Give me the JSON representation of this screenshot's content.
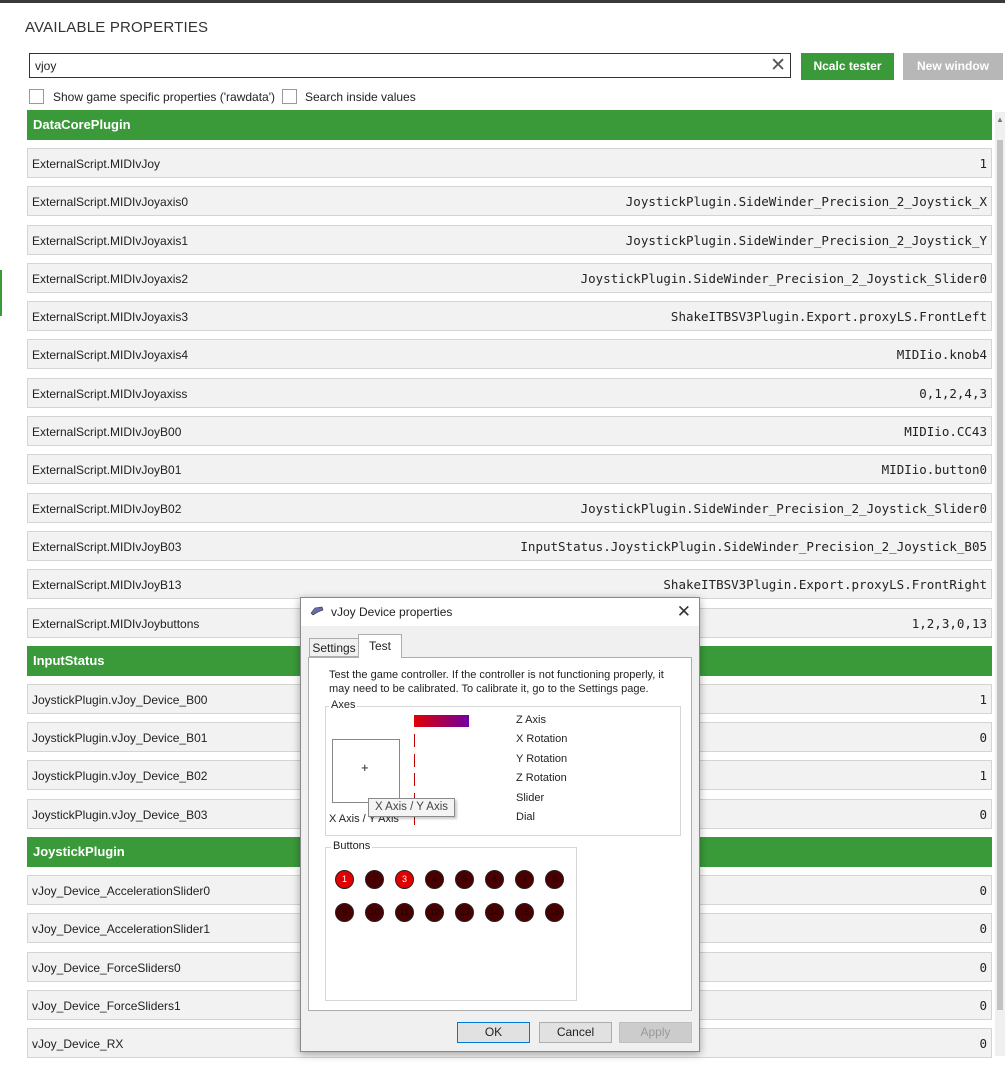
{
  "header": {
    "title": "AVAILABLE PROPERTIES",
    "search_value": "vjoy",
    "ncalc_label": "Ncalc tester",
    "new_window_label": "New window",
    "check_rawdata_label": "Show game specific properties ('rawdata')",
    "check_search_values_label": "Search inside values"
  },
  "groups": [
    {
      "name": "DataCorePlugin",
      "rows": [
        {
          "key": "ExternalScript.MIDIvJoy",
          "value": "1"
        },
        {
          "key": "ExternalScript.MIDIvJoyaxis0",
          "value": "JoystickPlugin.SideWinder_Precision_2_Joystick_X"
        },
        {
          "key": "ExternalScript.MIDIvJoyaxis1",
          "value": "JoystickPlugin.SideWinder_Precision_2_Joystick_Y"
        },
        {
          "key": "ExternalScript.MIDIvJoyaxis2",
          "value": "JoystickPlugin.SideWinder_Precision_2_Joystick_Slider0"
        },
        {
          "key": "ExternalScript.MIDIvJoyaxis3",
          "value": "ShakeITBSV3Plugin.Export.proxyLS.FrontLeft"
        },
        {
          "key": "ExternalScript.MIDIvJoyaxis4",
          "value": "MIDIio.knob4"
        },
        {
          "key": "ExternalScript.MIDIvJoyaxiss",
          "value": "0,1,2,4,3"
        },
        {
          "key": "ExternalScript.MIDIvJoyB00",
          "value": "MIDIio.CC43"
        },
        {
          "key": "ExternalScript.MIDIvJoyB01",
          "value": "MIDIio.button0"
        },
        {
          "key": "ExternalScript.MIDIvJoyB02",
          "value": "JoystickPlugin.SideWinder_Precision_2_Joystick_Slider0"
        },
        {
          "key": "ExternalScript.MIDIvJoyB03",
          "value": "InputStatus.JoystickPlugin.SideWinder_Precision_2_Joystick_B05"
        },
        {
          "key": "ExternalScript.MIDIvJoyB13",
          "value": "ShakeITBSV3Plugin.Export.proxyLS.FrontRight"
        },
        {
          "key": "ExternalScript.MIDIvJoybuttons",
          "value": "1,2,3,0,13"
        }
      ]
    },
    {
      "name": "InputStatus",
      "rows": [
        {
          "key": "JoystickPlugin.vJoy_Device_B00",
          "value": "1"
        },
        {
          "key": "JoystickPlugin.vJoy_Device_B01",
          "value": "0"
        },
        {
          "key": "JoystickPlugin.vJoy_Device_B02",
          "value": "1"
        },
        {
          "key": "JoystickPlugin.vJoy_Device_B03",
          "value": "0"
        }
      ]
    },
    {
      "name": "JoystickPlugin",
      "rows": [
        {
          "key": "vJoy_Device_AccelerationSlider0",
          "value": "0"
        },
        {
          "key": "vJoy_Device_AccelerationSlider1",
          "value": "0"
        },
        {
          "key": "vJoy_Device_ForceSliders0",
          "value": "0"
        },
        {
          "key": "vJoy_Device_ForceSliders1",
          "value": "0"
        },
        {
          "key": "vJoy_Device_RX",
          "value": "0"
        }
      ]
    }
  ],
  "dialog": {
    "title": "vJoy Device properties",
    "tabs": [
      "Settings",
      "Test"
    ],
    "active_tab": "Test",
    "description": "Test the game controller.  If the controller is not functioning properly, it may need to be calibrated.  To calibrate it, go to the Settings page.",
    "axes_label": "Axes",
    "xy_label": "X Axis / Y Axis",
    "tooltip": "X Axis / Y Axis",
    "axis_labels": [
      "Z Axis",
      "X Rotation",
      "Y Rotation",
      "Z Rotation",
      "Slider",
      "Dial"
    ],
    "buttons_label": "Buttons",
    "buttons": [
      {
        "num": "1",
        "pressed": true
      },
      {
        "num": "2",
        "pressed": false
      },
      {
        "num": "3",
        "pressed": true
      },
      {
        "num": "4",
        "pressed": false
      },
      {
        "num": "5",
        "pressed": false
      },
      {
        "num": "6",
        "pressed": false
      },
      {
        "num": "7",
        "pressed": false
      },
      {
        "num": "8",
        "pressed": false
      },
      {
        "num": "9",
        "pressed": false
      },
      {
        "num": "10",
        "pressed": false
      },
      {
        "num": "11",
        "pressed": false
      },
      {
        "num": "12",
        "pressed": false
      },
      {
        "num": "13",
        "pressed": false
      },
      {
        "num": "14",
        "pressed": false
      },
      {
        "num": "15",
        "pressed": false
      },
      {
        "num": "16",
        "pressed": false
      }
    ],
    "ok_label": "OK",
    "cancel_label": "Cancel",
    "apply_label": "Apply"
  },
  "colors": {
    "accent_green": "#3a9a3a",
    "button_disabled": "#b7b7b7",
    "led_on": "#e00000",
    "led_off": "#4a0000"
  }
}
